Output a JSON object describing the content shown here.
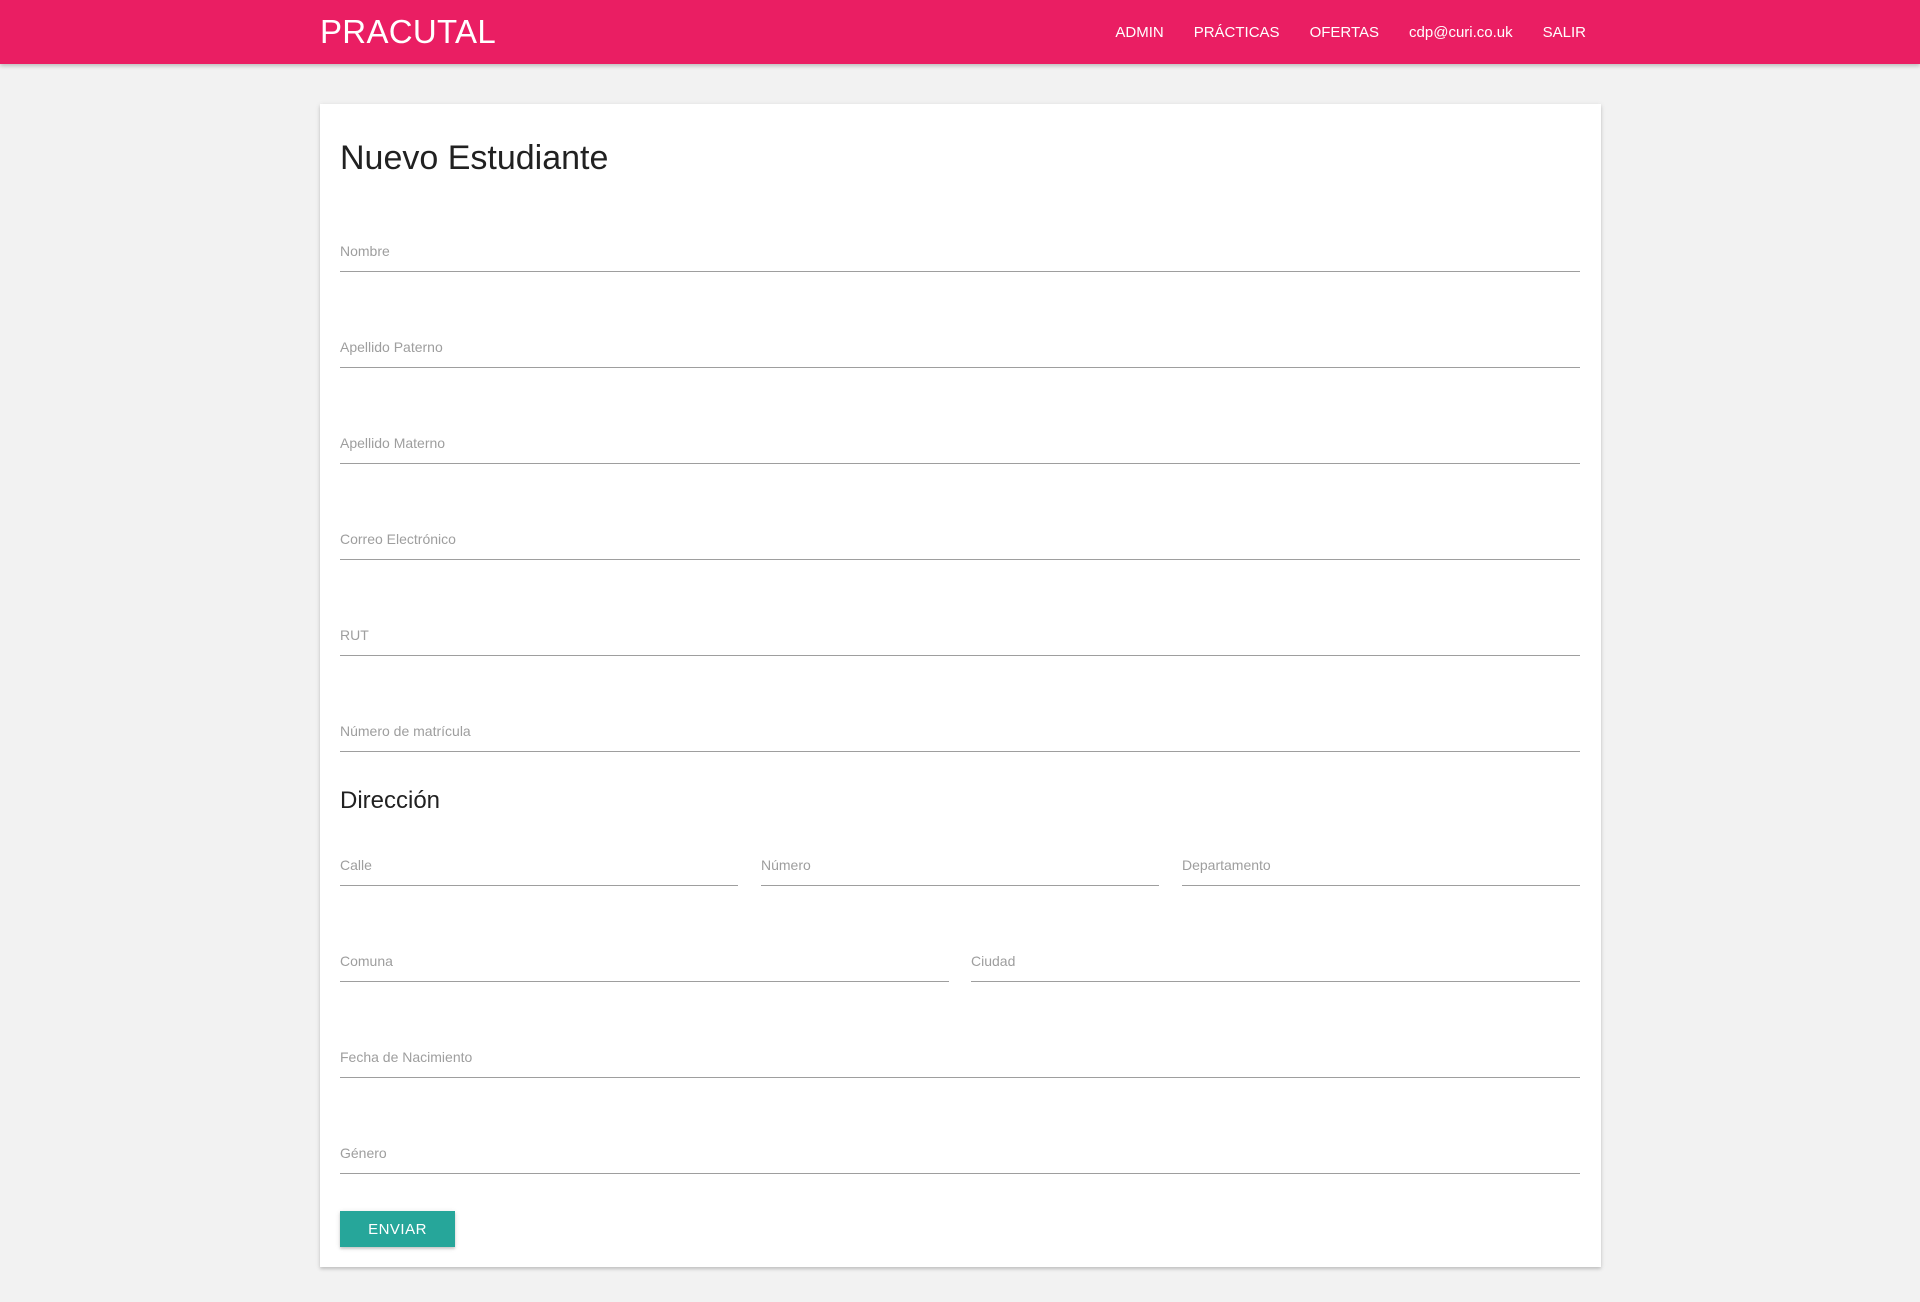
{
  "navbar": {
    "brand": "PRACUTAL",
    "links": [
      "ADMIN",
      "PRÁCTICAS",
      "OFERTAS",
      "cdp@curi.co.uk",
      "SALIR"
    ],
    "color": "#ea1e63"
  },
  "form": {
    "title": "Nuevo Estudiante",
    "fields": {
      "nombre": "Nombre",
      "apellido_paterno": "Apellido Paterno",
      "apellido_materno": "Apellido Materno",
      "correo": "Correo Electrónico",
      "rut": "RUT",
      "matricula": "Número de matrícula"
    },
    "address": {
      "title": "Dirección",
      "calle": "Calle",
      "numero": "Número",
      "departamento": "Departamento",
      "comuna": "Comuna",
      "ciudad": "Ciudad"
    },
    "fecha_nacimiento": "Fecha de Nacimiento",
    "genero": "Género",
    "submit": "ENVIAR",
    "submit_color": "#26a69a"
  }
}
